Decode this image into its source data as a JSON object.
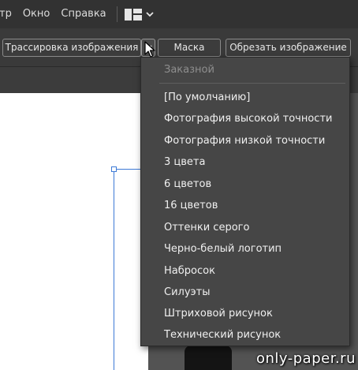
{
  "menubar": {
    "items": [
      "тр",
      "Окно",
      "Справка"
    ]
  },
  "control_bar": {
    "trace_label": "Трассировка изображения",
    "mask_label": "Маска",
    "crop_label": "Обрезать изображение"
  },
  "dropdown": {
    "header": "Заказной",
    "items": [
      "[По умолчанию]",
      "Фотография высокой точности",
      "Фотография низкой точности",
      "3 цвета",
      "6 цветов",
      "16 цветов",
      "Оттенки серого",
      "Черно-белый логотип",
      "Набросок",
      "Силуэты",
      "Штриховой рисунок",
      "Технический рисунок"
    ]
  },
  "watermark": "only-paper.ru",
  "colors": {
    "menubar_bg": "#323232",
    "control_bar_bg": "#3a3a3a",
    "dropdown_bg": "#464646",
    "selection": "#3d7ad6"
  }
}
